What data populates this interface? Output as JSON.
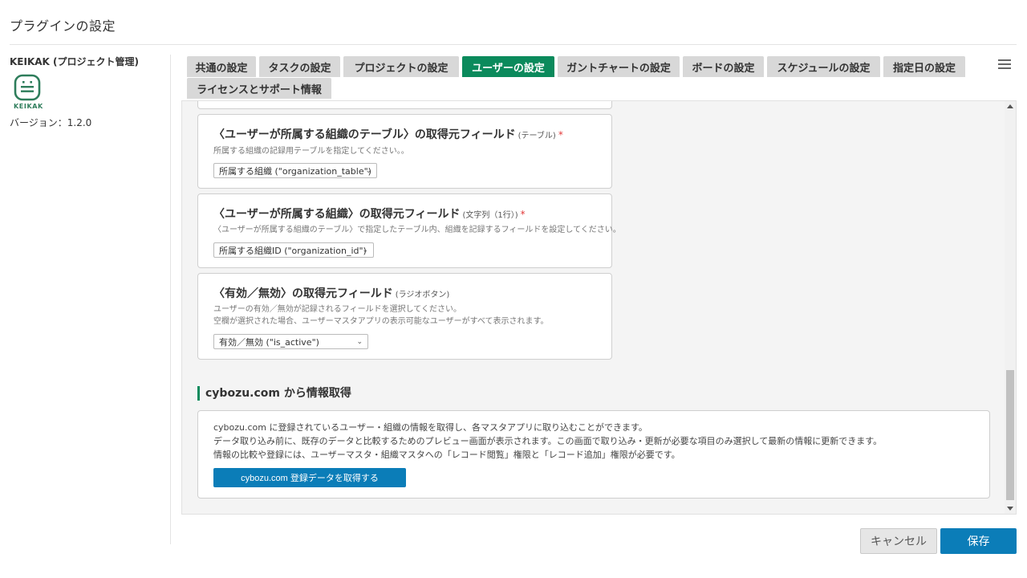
{
  "page": {
    "title": "プラグインの設定"
  },
  "sidebar": {
    "plugin_name": "KEIKAK (プロジェクト管理)",
    "logo_text": "KEIKAK",
    "logo_icon": "keikak-logo-icon",
    "version": "バージョン：1.2.0"
  },
  "tabs": [
    {
      "label": "共通の設定",
      "active": false
    },
    {
      "label": "タスクの設定",
      "active": false
    },
    {
      "label": "プロジェクトの設定",
      "active": false
    },
    {
      "label": "ユーザーの設定",
      "active": true
    },
    {
      "label": "ガントチャートの設定",
      "active": false
    },
    {
      "label": "ボードの設定",
      "active": false
    },
    {
      "label": "スケジュールの設定",
      "active": false
    },
    {
      "label": "指定日の設定",
      "active": false
    },
    {
      "label": "ライセンスとサポート情報",
      "active": false
    }
  ],
  "fields": [
    {
      "title": "〈ユーザーが所属する組織のテーブル〉の取得元フィールド",
      "type": "(テーブル)",
      "required": "*",
      "description": "所属する組織の記録用テーブルを指定してください。。",
      "select_value": "所属する組織 (\"organization_table\")"
    },
    {
      "title": "〈ユーザーが所属する組織〉の取得元フィールド",
      "type": "(文字列（1行）)",
      "required": "*",
      "description": "〈ユーザーが所属する組織のテーブル〉で指定したテーブル内、組織を記録するフィールドを設定してください。",
      "select_value": "所属する組織ID (\"organization_id\")"
    },
    {
      "title": "〈有効／無効〉の取得元フィールド",
      "type": "(ラジオボタン)",
      "description_line1": "ユーザーの有効／無効が記録されるフィールドを選択してください。",
      "description_line2": "空欄が選択された場合、ユーザーマスタアプリの表示可能なユーザーがすべて表示されます。",
      "select_value": "有効／無効 (\"is_active\")"
    }
  ],
  "cybozu": {
    "heading": "cybozu.com から情報取得",
    "line1": "cybozu.com に登録されているユーザー・組織の情報を取得し、各マスタアプリに取り込むことができます。",
    "line2": "データ取り込み前に、既存のデータと比較するためのプレビュー画面が表示されます。この画面で取り込み・更新が必要な項目のみ選択して最新の情報に更新できます。",
    "line3": "情報の比較や登録には、ユーザーマスタ・組織マスタへの「レコード閲覧」権限と「レコード追加」権限が必要です。",
    "button": "cybozu.com 登録データを取得する"
  },
  "footer": {
    "cancel": "キャンセル",
    "save": "保存"
  },
  "colors": {
    "accent": "#0b8a5c",
    "primary_button": "#0b7db8",
    "required": "#e23a3a"
  }
}
